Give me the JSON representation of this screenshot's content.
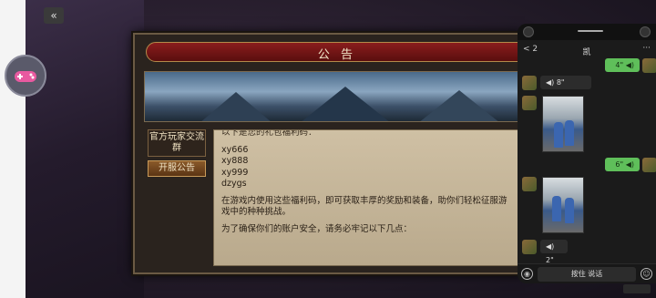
{
  "dialog": {
    "title": "公 告",
    "side_buttons": [
      "官方玩家交流群",
      "开服公告"
    ],
    "content": {
      "cut_line": "以下是您的礼包福利码：",
      "codes": [
        "xy666",
        "xy888",
        "xy999",
        "dzygs"
      ],
      "para1": "在游戏内使用这些福利码，即可获取丰厚的奖励和装备，助你们轻松征服游戏中的种种挑战。",
      "para2": "为了确保你们的账户安全，请务必牢记以下几点："
    }
  },
  "chat": {
    "back_label": "< 2",
    "contact_name": "凯",
    "more_icon": "···",
    "messages": [
      {
        "side": "out",
        "text": "4\" ◀)"
      },
      {
        "side": "in",
        "text": "◀) 8\""
      },
      {
        "side": "in",
        "type": "photo"
      },
      {
        "side": "out",
        "text": "6\" ◀)"
      },
      {
        "side": "in",
        "type": "photo"
      },
      {
        "side": "in",
        "text": "◀) 2\""
      }
    ],
    "voice_label": "按住 说话",
    "left_icon": "voice-icon",
    "right_icon": "emoji-icon"
  },
  "game": {
    "back_icon": "back-arrow-icon",
    "gamepad_icon": "gamepad-icon"
  }
}
